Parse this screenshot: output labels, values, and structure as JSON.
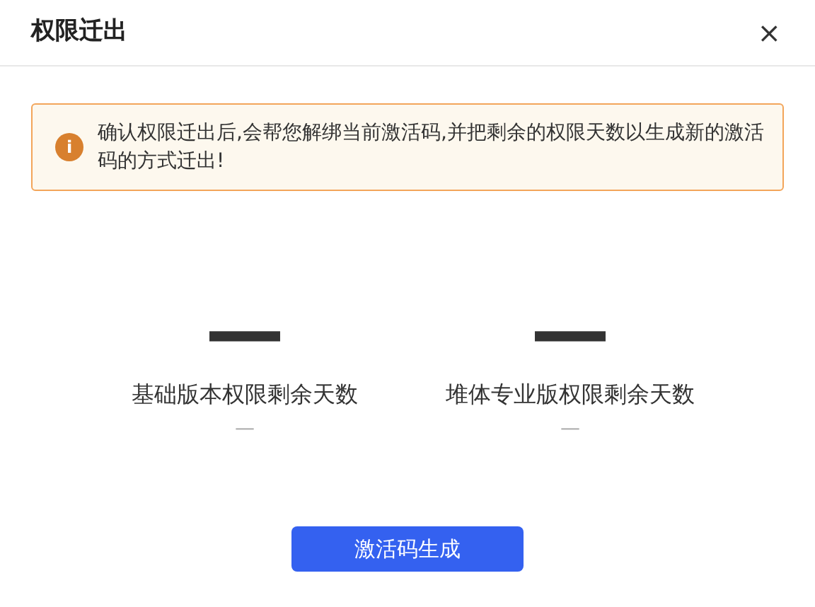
{
  "dialog": {
    "title": "权限迁出",
    "close": "×"
  },
  "alert": {
    "icon": "i",
    "text": "确认权限迁出后,会帮您解绑当前激活码,并把剩余的权限天数以生成新的激活码的方式迁出!"
  },
  "stats": [
    {
      "value": "—",
      "label": "基础版本权限剩余天数",
      "sub": "—"
    },
    {
      "value": "—",
      "label": "堆体专业版权限剩余天数",
      "sub": "—"
    }
  ],
  "button": "激活码生成"
}
